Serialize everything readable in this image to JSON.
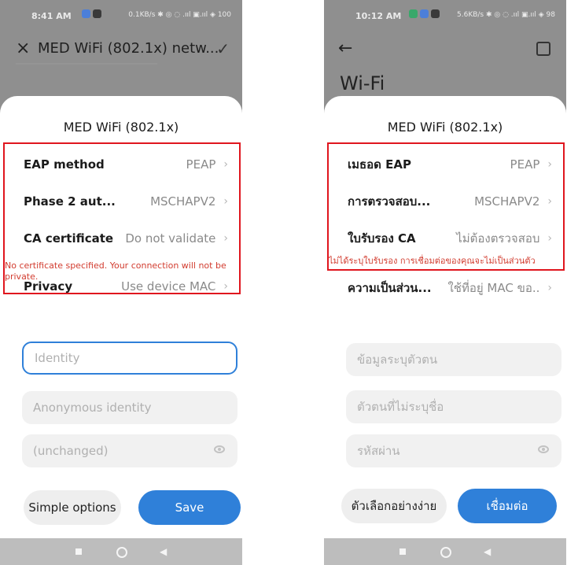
{
  "left": {
    "status": {
      "time": "8:41 AM",
      "network": "0.1KB/s ✱ ◎ ◌ .ııl ▣.ııl ◈ 100"
    },
    "topbar": {
      "title": "MED WiFi (802.1x) netw..."
    },
    "sheet": {
      "title": "MED WiFi (802.1x)",
      "rows": [
        {
          "label": "EAP method",
          "value": "PEAP"
        },
        {
          "label": "Phase 2 aut...",
          "value": "MSCHAPV2"
        },
        {
          "label": "CA certificate",
          "value": "Do not validate"
        }
      ],
      "warning": "No certificate specified. Your connection will not be private.",
      "privacy": {
        "label": "Privacy",
        "value": "Use device MAC"
      },
      "fields": {
        "identity": "Identity",
        "anonymous": "Anonymous identity",
        "password": "(unchanged)"
      },
      "buttons": {
        "simple": "Simple options",
        "save": "Save"
      }
    }
  },
  "right": {
    "status": {
      "time": "10:12 AM",
      "network": "5.6KB/s ✱ ◎ ◌ .ııl ▣.ııl ◈ 98"
    },
    "page_title": "Wi-Fi",
    "sheet": {
      "title": "MED WiFi (802.1x)",
      "rows": [
        {
          "label": "เมธอด EAP",
          "value": "PEAP"
        },
        {
          "label": "การตรวจสอบ...",
          "value": "MSCHAPV2"
        },
        {
          "label": "ใบรับรอง CA",
          "value": "ไม่ต้องตรวจสอบ"
        }
      ],
      "warning": "ไม่ได้ระบุใบรับรอง การเชื่อมต่อของคุณจะไม่เป็นส่วนตัว",
      "privacy": {
        "label": "ความเป็นส่วน...",
        "value": "ใช้ที่อยู่ MAC ขอ.."
      },
      "fields": {
        "identity": "ข้อมูลระบุตัวตน",
        "anonymous": "ตัวตนที่ไม่ระบุชื่อ",
        "password": "รหัสผ่าน"
      },
      "buttons": {
        "simple": "ตัวเลือกอย่างง่าย",
        "save": "เชื่อมต่อ"
      }
    }
  },
  "icons": {
    "close": "×",
    "check": "✓",
    "back": "←",
    "chevron": "›"
  },
  "colors": {
    "accent": "#2f80d9",
    "warning": "#d23c2f",
    "highlight_border": "#e0161e"
  }
}
